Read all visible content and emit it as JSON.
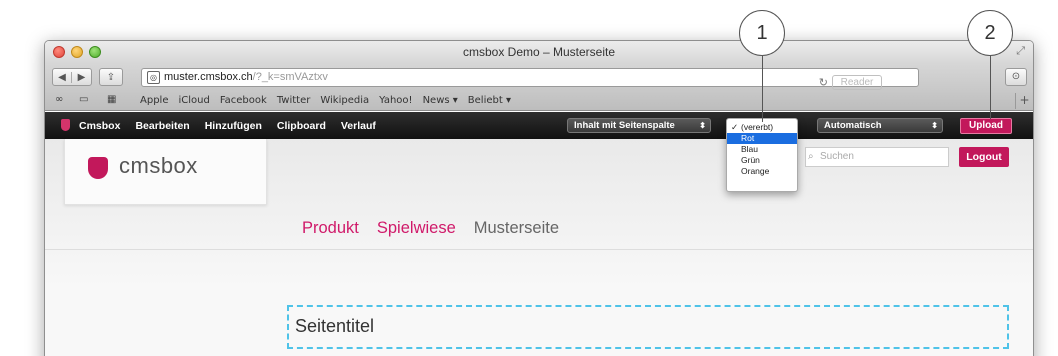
{
  "window": {
    "title": "cmsbox Demo – Musterseite"
  },
  "toolbar": {
    "back_icon": "◀",
    "forward_icon": "▶",
    "url_domain": "muster.cmsbox.ch",
    "url_path": "/?_k=smVAztxv",
    "reader_label": "Reader"
  },
  "bookmarks": {
    "items": [
      "Apple",
      "iCloud",
      "Facebook",
      "Twitter",
      "Wikipedia",
      "Yahoo!",
      "News ▾",
      "Beliebt ▾"
    ]
  },
  "cmsbar": {
    "nav": [
      "Cmsbox",
      "Bearbeiten",
      "Hinzufügen",
      "Clipboard",
      "Verlauf"
    ],
    "layout_select": "Inhalt mit Seitenspalte",
    "auto_select": "Automatisch",
    "upload_label": "Upload"
  },
  "dropdown": {
    "options": [
      "(vererbt)",
      "Rot",
      "Blau",
      "Grün",
      "Orange"
    ],
    "checked_index": 0,
    "highlighted_index": 1
  },
  "header": {
    "logo_text": "cmsbox",
    "search_placeholder": "Suchen",
    "logout_label": "Logout"
  },
  "main_nav": {
    "items": [
      "Produkt",
      "Spielwiese",
      "Musterseite"
    ],
    "active_index": 2
  },
  "content": {
    "page_title": "Seitentitel"
  },
  "callouts": [
    "1",
    "2"
  ],
  "colors": {
    "accent": "#c2185b",
    "link": "#d01a6a",
    "edit_frame": "#4fc3e8",
    "dropdown_highlight": "#1a6de0"
  }
}
